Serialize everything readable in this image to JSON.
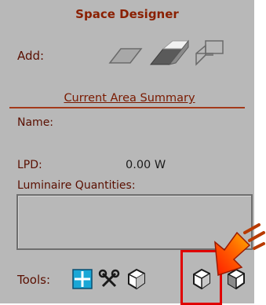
{
  "panel": {
    "title": "Space Designer",
    "add_label": "Add:",
    "summary_title": "Current Area Summary",
    "name_label": "Name:",
    "lpd_label": "LPD:",
    "lpd_value": "0.00 W",
    "luminaire_label": "Luminaire Quantities:",
    "tools_label": "Tools:"
  },
  "icons": {
    "add": [
      "flat-plane-icon",
      "slab-icon",
      "wireframe-box-icon"
    ],
    "tools": [
      "grid-icon",
      "scissors-icon",
      "shape-icon",
      "shape-icon",
      "shape-icon"
    ]
  },
  "colors": {
    "panel_bg": "#b8b8b8",
    "text": "#5a0f00",
    "highlight": "#e00000",
    "grid_icon": "#1aa7d6"
  }
}
